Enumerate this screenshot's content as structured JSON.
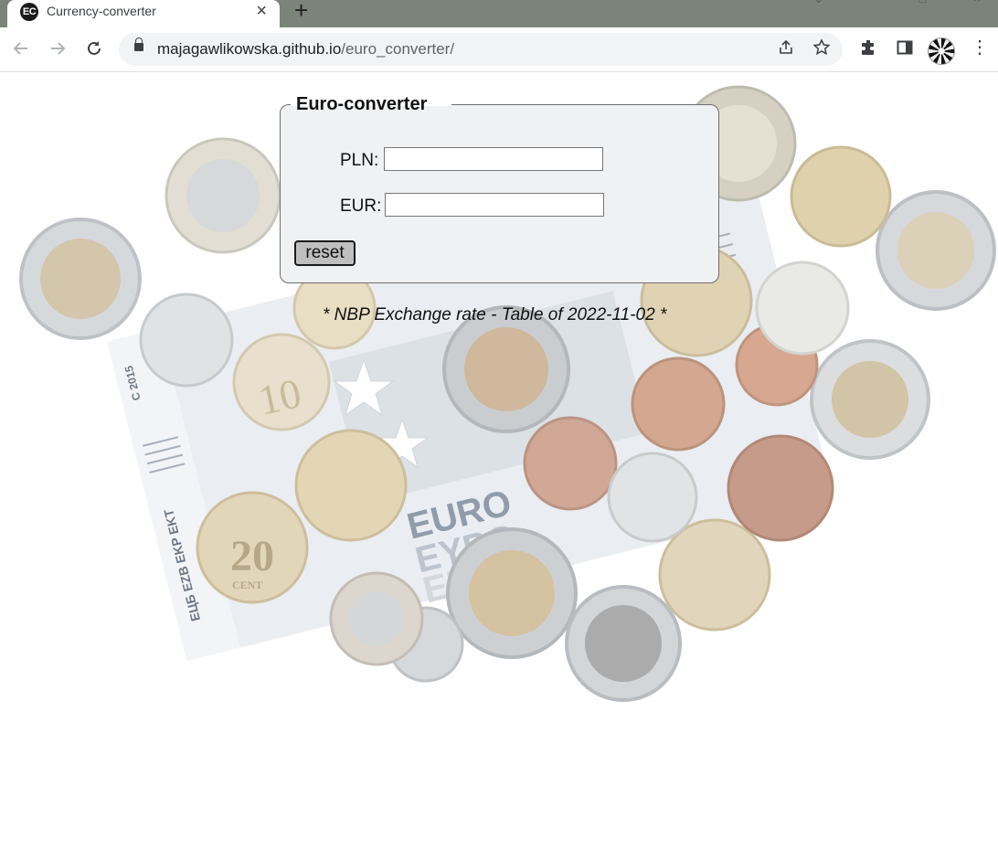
{
  "browser": {
    "tab_title": "Currency-converter",
    "favicon_text": "EC",
    "new_tab_symbol": "+",
    "close_symbol": "×",
    "url_host": "majagawlikowska.github.io",
    "url_path": "/euro_converter/"
  },
  "form": {
    "legend": "Euro-converter",
    "pln_label": "PLN:",
    "pln_value": "",
    "eur_label": "EUR:",
    "eur_value": "",
    "reset_label": "reset"
  },
  "note": "* NBP Exchange rate - Table of 2022-11-02 *",
  "background_art": {
    "banknote_text_top": "EURO",
    "banknote_text_mid": "ΕΥΡΩ",
    "banknote_text_bottom": "ΕΒΡΟ",
    "banknote_side_text": "ЕЦБ EZB EKP EKT",
    "banknote_year": "C 2015",
    "coin_20": "20",
    "coin_20_unit": "CENT",
    "coin_10": "10"
  },
  "colors": {
    "tabstrip": "#7b8479",
    "fieldset_bg": "#f0f1f2",
    "reset_bg": "#bfbfbf"
  }
}
